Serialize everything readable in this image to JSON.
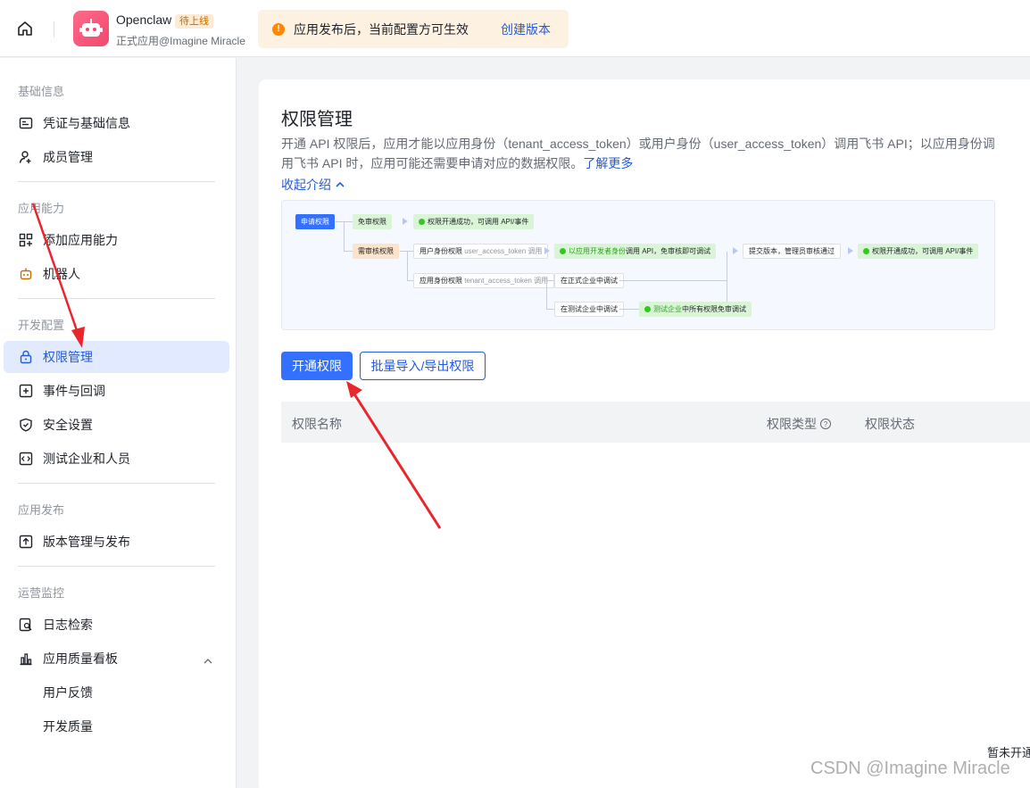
{
  "topbar": {
    "app_name": "Openclaw",
    "app_status": "待上线",
    "app_subtitle": "正式应用@Imagine Miracle",
    "notice_text": "应用发布后，当前配置方可生效",
    "notice_link": "创建版本"
  },
  "sidebar": {
    "sections": [
      {
        "title": "基础信息",
        "items": [
          "凭证与基础信息",
          "成员管理"
        ]
      },
      {
        "title": "应用能力",
        "items": [
          "添加应用能力",
          "机器人"
        ]
      },
      {
        "title": "开发配置",
        "items": [
          "权限管理",
          "事件与回调",
          "安全设置",
          "测试企业和人员"
        ]
      },
      {
        "title": "应用发布",
        "items": [
          "版本管理与发布"
        ]
      },
      {
        "title": "运营监控",
        "items": [
          "日志检索",
          "应用质量看板",
          "用户反馈",
          "开发质量"
        ]
      }
    ],
    "active_item": "权限管理"
  },
  "main": {
    "title": "权限管理",
    "description": "开通 API 权限后，应用才能以应用身份（tenant_access_token）或用户身份（user_access_token）调用飞书 API；以应用身份调用飞书 API 时，应用可能还需要申请对应的数据权限。",
    "learn_more": "了解更多",
    "collapse": "收起介绍",
    "flow": {
      "apply": "申请权限",
      "no_review": "免审权限",
      "success": "权限开通成功，可调用 API/事件",
      "need_review": "需审核权限",
      "user_identity": "用户身份权限",
      "user_token": "user_access_token 调用",
      "dev_debug_prefix": "以应用开发者身份",
      "dev_debug_suffix": "调用 API，免审核即可调试",
      "submit": "提交版本，管理员审核通过",
      "app_identity": "应用身份权限",
      "tenant_token": "tenant_access_token 调用",
      "prod_debug": "在正式企业中调试",
      "test_debug": "在测试企业中调试",
      "test_all_prefix": "测试企业",
      "test_all_suffix": "中所有权限免审调试"
    },
    "btn_enable": "开通权限",
    "btn_batch": "批量导入/导出权限",
    "table": {
      "col_name": "权限名称",
      "col_type": "权限类型",
      "col_status": "权限状态"
    },
    "empty_text": "暂未开通"
  },
  "watermark": "CSDN @Imagine Miracle",
  "colors": {
    "primary": "#3370ff",
    "link": "#245bdb",
    "arrow": "#e8262b"
  }
}
